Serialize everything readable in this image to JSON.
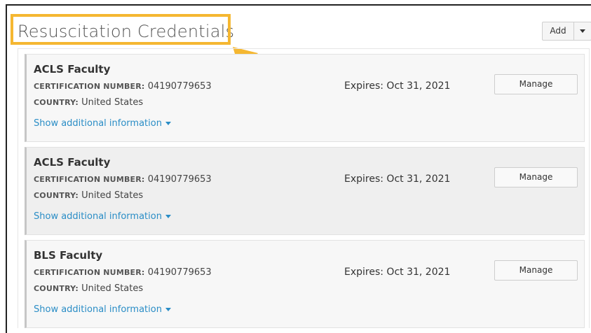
{
  "header": {
    "title": "Resuscitation Credentials",
    "add_label": "Add",
    "highlight_color": "#f5b731"
  },
  "credentials": [
    {
      "title": "ACLS Faculty",
      "cert_label": "CERTIFICATION NUMBER:",
      "cert_number": "04190779653",
      "country_label": "COUNTRY:",
      "country": "United States",
      "expires": "Expires: Oct 31, 2021",
      "manage_label": "Manage",
      "more_label": "Show additional information"
    },
    {
      "title": "ACLS Faculty",
      "cert_label": "CERTIFICATION NUMBER:",
      "cert_number": "04190779653",
      "country_label": "COUNTRY:",
      "country": "United States",
      "expires": "Expires: Oct 31, 2021",
      "manage_label": "Manage",
      "more_label": "Show additional information"
    },
    {
      "title": "BLS Faculty",
      "cert_label": "CERTIFICATION NUMBER:",
      "cert_number": "04190779653",
      "country_label": "COUNTRY:",
      "country": "United States",
      "expires": "Expires: Oct 31, 2021",
      "manage_label": "Manage",
      "more_label": "Show additional information"
    }
  ],
  "link_color": "#2a8dc6"
}
